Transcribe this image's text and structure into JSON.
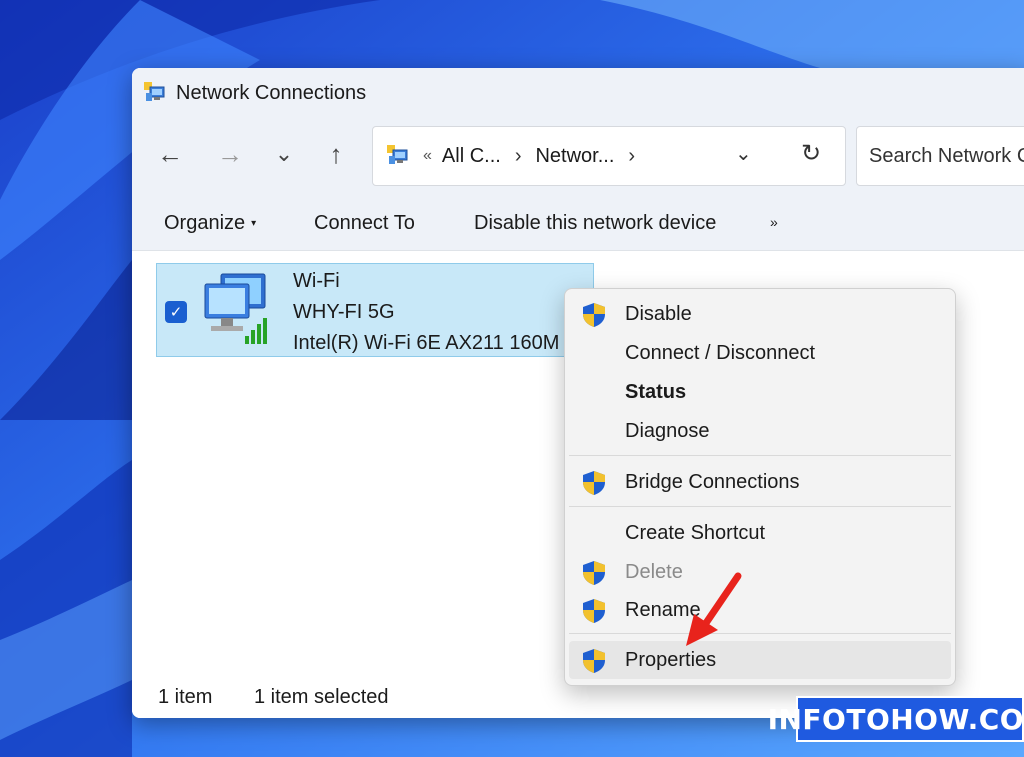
{
  "window": {
    "title": "Network Connections"
  },
  "nav": {
    "back_icon": "←",
    "forward_icon": "→",
    "recent_icon": "⌄",
    "up_icon": "↑"
  },
  "address": {
    "overflow": "«",
    "crumb1": "All C...",
    "crumb2": "Networ...",
    "sep": "›",
    "dropdown_icon": "⌄",
    "refresh_icon": "↻"
  },
  "search": {
    "placeholder": "Search Network C"
  },
  "toolbar": {
    "organize": "Organize",
    "organize_caret": "▾",
    "connect_to": "Connect To",
    "disable_device": "Disable this network device",
    "more": "»"
  },
  "item": {
    "name": "Wi-Fi",
    "network": "WHY-FI 5G",
    "adapter": "Intel(R) Wi-Fi 6E AX211 160M",
    "check": "✓"
  },
  "status": {
    "count": "1 item",
    "selected": "1 item selected"
  },
  "context_menu": {
    "disable": "Disable",
    "connect_disconnect": "Connect / Disconnect",
    "status": "Status",
    "diagnose": "Diagnose",
    "bridge": "Bridge Connections",
    "create_shortcut": "Create Shortcut",
    "delete": "Delete",
    "rename": "Rename",
    "properties": "Properties"
  },
  "watermark": "INFOTOHOW.COM",
  "colors": {
    "accent": "#1a5fd0",
    "selection": "#c8e8f8",
    "arrow": "#e8231c",
    "wallpaper": "#1f4fd8"
  }
}
